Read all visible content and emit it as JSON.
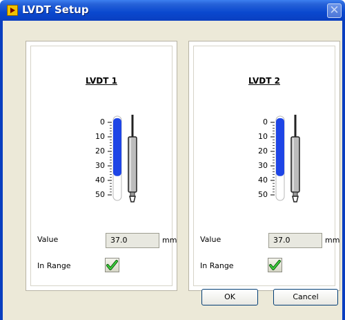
{
  "window": {
    "title": "LVDT Setup",
    "close_glyph": "✕",
    "app_icon": "labview-icon"
  },
  "gauge_scale": {
    "ticks": [
      "0",
      "10",
      "20",
      "30",
      "40",
      "50"
    ],
    "min": 0,
    "max": 50
  },
  "sensors": [
    {
      "title": "LVDT 1",
      "value_label": "Value",
      "value": "37.0",
      "unit": "mm",
      "in_range_label": "In Range",
      "in_range": true,
      "gauge_level": 37.0
    },
    {
      "title": "LVDT 2",
      "value_label": "Value",
      "value": "37.0",
      "unit": "mm",
      "in_range_label": "In Range",
      "in_range": true,
      "gauge_level": 37.0
    }
  ],
  "buttons": {
    "ok": "OK",
    "cancel": "Cancel"
  },
  "colors": {
    "titlebar": "#0a48cf",
    "gauge_fill": "#1e45e6",
    "check_green": "#2eb82e"
  }
}
